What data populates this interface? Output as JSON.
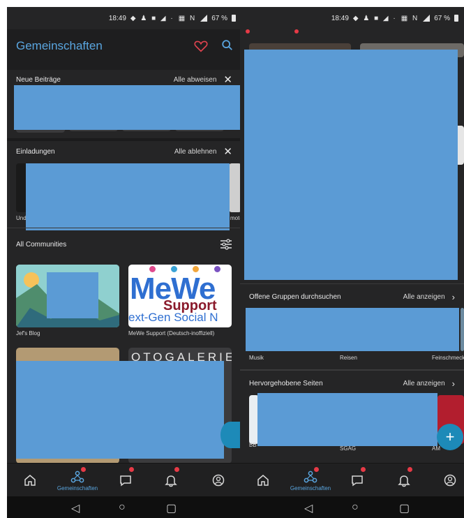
{
  "left": {
    "status": {
      "time": "18:49",
      "battery": "67 %"
    },
    "header": {
      "title": "Gemeinschaften"
    },
    "new_posts": {
      "title": "Neue Beiträge",
      "action": "Alle abweisen"
    },
    "invitations": {
      "title": "Einladungen",
      "action": "Alle ablehnen",
      "caption_left": "Und",
      "caption_right": "moto"
    },
    "communities": {
      "title": "All Communities",
      "items": [
        {
          "name": "Jef's Blog"
        },
        {
          "name": "MeWe Support (Deutsch-inoffiziell)",
          "logo_text": "MeWe",
          "logo_sub": "Support",
          "logo_tag": "ext-Gen Social N"
        },
        {
          "name": "",
          "logo_text": ""
        },
        {
          "name": "",
          "logo_text": "OTOGALERIE"
        }
      ]
    },
    "nav": {
      "active_label": "Gemeinschaften"
    }
  },
  "right": {
    "status": {
      "time": "18:49",
      "battery": "67 %"
    },
    "top_captions": [
      "",
      ""
    ],
    "open_groups": {
      "title": "Offene Gruppen durchsuchen",
      "action": "Alle anzeigen",
      "captions": [
        "Musik",
        "Reisen",
        "Feinschmeck"
      ]
    },
    "featured": {
      "title": "Hervorgehobene Seiten",
      "action": "Alle anzeigen",
      "captions": [
        "BB",
        "SGAG",
        "AM"
      ]
    },
    "nav": {
      "active_label": "Gemeinschaften"
    }
  },
  "colors": {
    "accent": "#5aa6e0",
    "redaction": "#5b9bd5",
    "badge": "#e63a46",
    "fab": "#1d8ab8"
  }
}
